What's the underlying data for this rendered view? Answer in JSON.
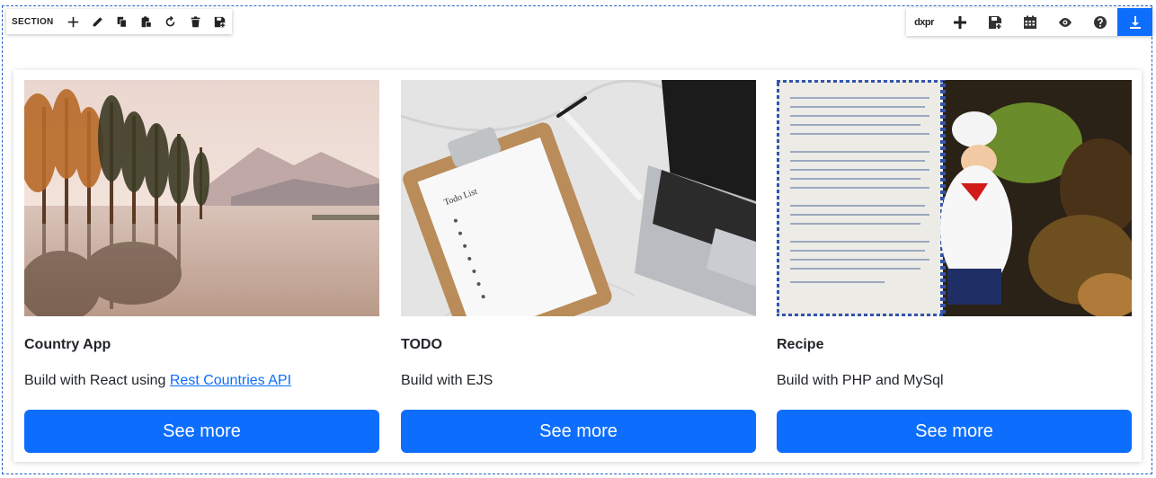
{
  "section_toolbar": {
    "label": "SECTION",
    "icons": [
      "plus-icon",
      "pencil-icon",
      "copy-icon",
      "paste-icon",
      "refresh-icon",
      "trash-icon",
      "save-icon"
    ]
  },
  "main_toolbar": {
    "brand": "dxpr",
    "icons": [
      "plus-icon",
      "save-icon",
      "calendar-icon",
      "eye-icon",
      "help-icon",
      "download-icon"
    ]
  },
  "cards": [
    {
      "title": "Country App",
      "text_prefix": "Build with React using ",
      "link_text": "Rest Countries API",
      "button": "See more",
      "image": "lake-with-trees"
    },
    {
      "title": "TODO",
      "text_prefix": "Build with EJS",
      "link_text": "",
      "button": "See more",
      "image": "clipboard-todo-list-laptop"
    },
    {
      "title": "Recipe",
      "text_prefix": "Build with PHP and MySql",
      "link_text": "",
      "button": "See more",
      "image": "chef-figurine-recipe"
    }
  ],
  "todo_image_text": "Todo List",
  "colors": {
    "primary": "#0d6efd",
    "frame": "#2a62c7"
  }
}
